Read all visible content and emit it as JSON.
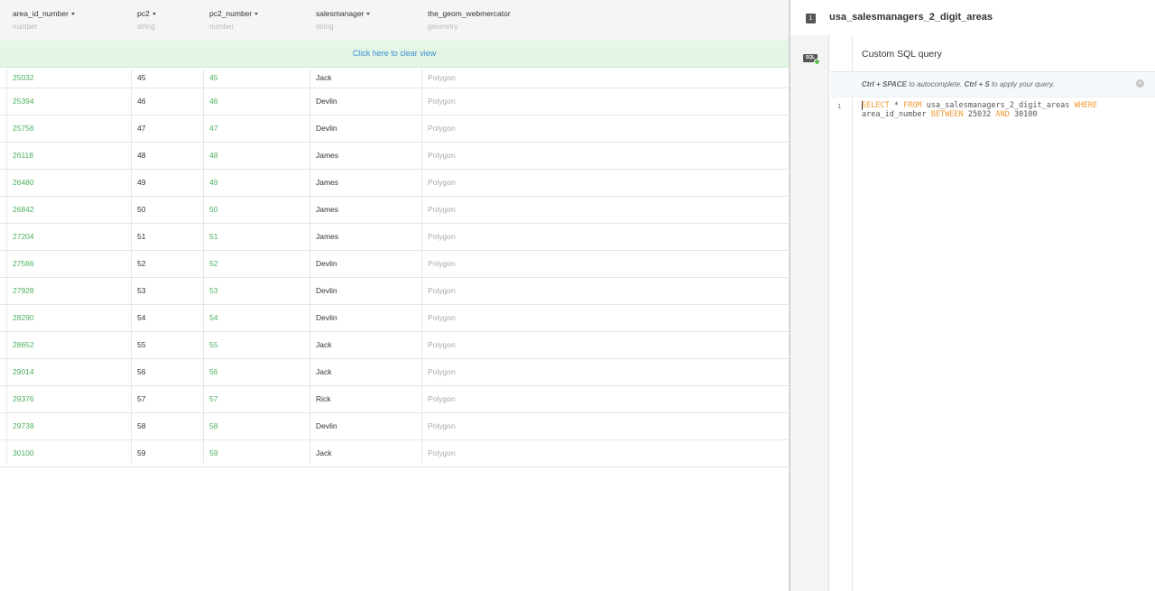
{
  "table": {
    "columns": [
      {
        "name": "area_id_number",
        "type": "number",
        "sortable": true
      },
      {
        "name": "pc2",
        "type": "string",
        "sortable": true
      },
      {
        "name": "pc2_number",
        "type": "number",
        "sortable": true
      },
      {
        "name": "salesmanager",
        "type": "string",
        "sortable": true
      },
      {
        "name": "the_geom_webmercator",
        "type": "geometry",
        "sortable": false
      }
    ],
    "clear_view_label": "Click here to clear view",
    "rows": [
      [
        "25032",
        "45",
        "45",
        "Jack",
        "Polygon"
      ],
      [
        "25394",
        "46",
        "46",
        "Devlin",
        "Polygon"
      ],
      [
        "25756",
        "47",
        "47",
        "Devlin",
        "Polygon"
      ],
      [
        "26118",
        "48",
        "48",
        "James",
        "Polygon"
      ],
      [
        "26480",
        "49",
        "49",
        "James",
        "Polygon"
      ],
      [
        "26842",
        "50",
        "50",
        "James",
        "Polygon"
      ],
      [
        "27204",
        "51",
        "51",
        "James",
        "Polygon"
      ],
      [
        "27566",
        "52",
        "52",
        "Devlin",
        "Polygon"
      ],
      [
        "27928",
        "53",
        "53",
        "Devlin",
        "Polygon"
      ],
      [
        "28290",
        "54",
        "54",
        "Devlin",
        "Polygon"
      ],
      [
        "28652",
        "55",
        "55",
        "Jack",
        "Polygon"
      ],
      [
        "29014",
        "56",
        "56",
        "Jack",
        "Polygon"
      ],
      [
        "29376",
        "57",
        "57",
        "Rick",
        "Polygon"
      ],
      [
        "29738",
        "58",
        "58",
        "Devlin",
        "Polygon"
      ],
      [
        "30100",
        "59",
        "59",
        "Jack",
        "Polygon"
      ]
    ]
  },
  "panel": {
    "layer_number": "1",
    "layer_title": "usa_salesmanagers_2_digit_areas",
    "sidebar_icon": "sql-icon",
    "sql_icon_label": "SQL",
    "editor_title": "Custom SQL query",
    "hint": {
      "key1": "Ctrl + SPACE",
      "text1": " to autocomplete. ",
      "key2": "Ctrl + S",
      "text2": " to apply your query."
    },
    "close_icon": "close-icon",
    "line_number": "1",
    "query_tokens": [
      {
        "t": "SELECT",
        "kw": true
      },
      {
        "t": " * ",
        "kw": false
      },
      {
        "t": "FROM",
        "kw": true
      },
      {
        "t": " usa_salesmanagers_2_digit_areas ",
        "kw": false
      },
      {
        "t": "WHERE",
        "kw": true
      },
      {
        "t": " area_id_number ",
        "kw": false
      },
      {
        "t": "BETWEEN",
        "kw": true
      },
      {
        "t": " 25032 ",
        "kw": false
      },
      {
        "t": "AND",
        "kw": true
      },
      {
        "t": " 30100",
        "kw": false
      }
    ]
  },
  "colors": {
    "link_green": "#4db25d",
    "keyword_orange": "#f29b35",
    "banner_bg": "#e4f6e6",
    "banner_text": "#3a8fcf"
  }
}
